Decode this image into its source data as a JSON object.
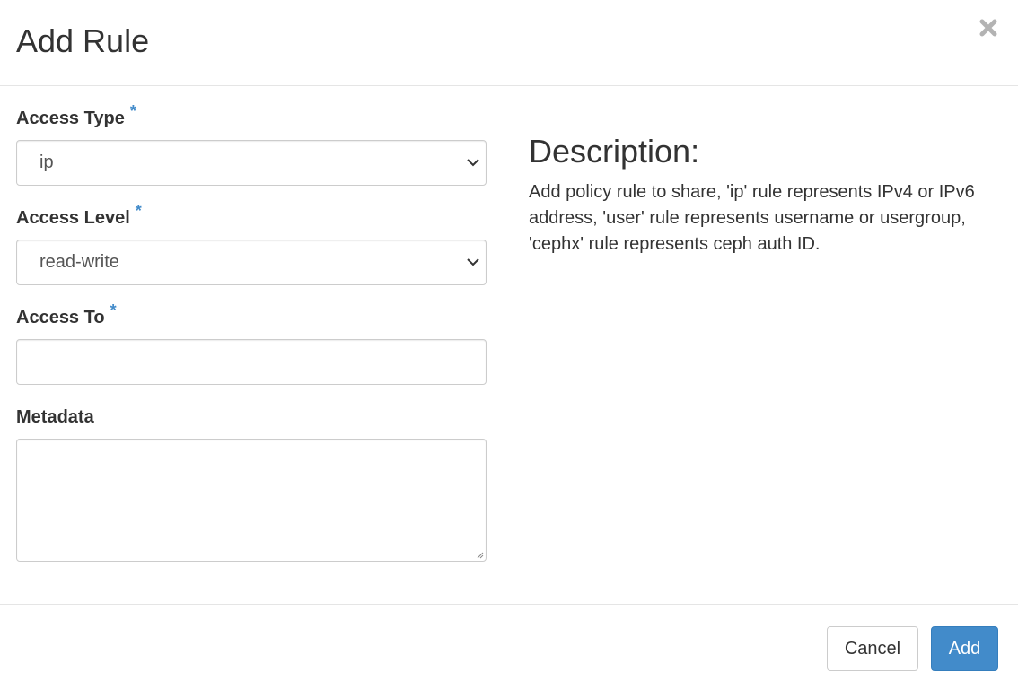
{
  "header": {
    "title": "Add Rule",
    "close_icon": "close-icon"
  },
  "form": {
    "required_marker": "*",
    "access_type": {
      "label": "Access Type",
      "value": "ip"
    },
    "access_level": {
      "label": "Access Level",
      "value": "read-write"
    },
    "access_to": {
      "label": "Access To",
      "value": ""
    },
    "metadata": {
      "label": "Metadata",
      "value": ""
    }
  },
  "description": {
    "title": "Description:",
    "text": "Add policy rule to share, 'ip' rule represents IPv4 or IPv6 address, 'user' rule represents username or usergroup, 'cephx' rule represents ceph auth ID."
  },
  "footer": {
    "cancel_label": "Cancel",
    "add_label": "Add"
  },
  "colors": {
    "accent": "#428bca",
    "border": "#cccccc",
    "text": "#333333"
  }
}
